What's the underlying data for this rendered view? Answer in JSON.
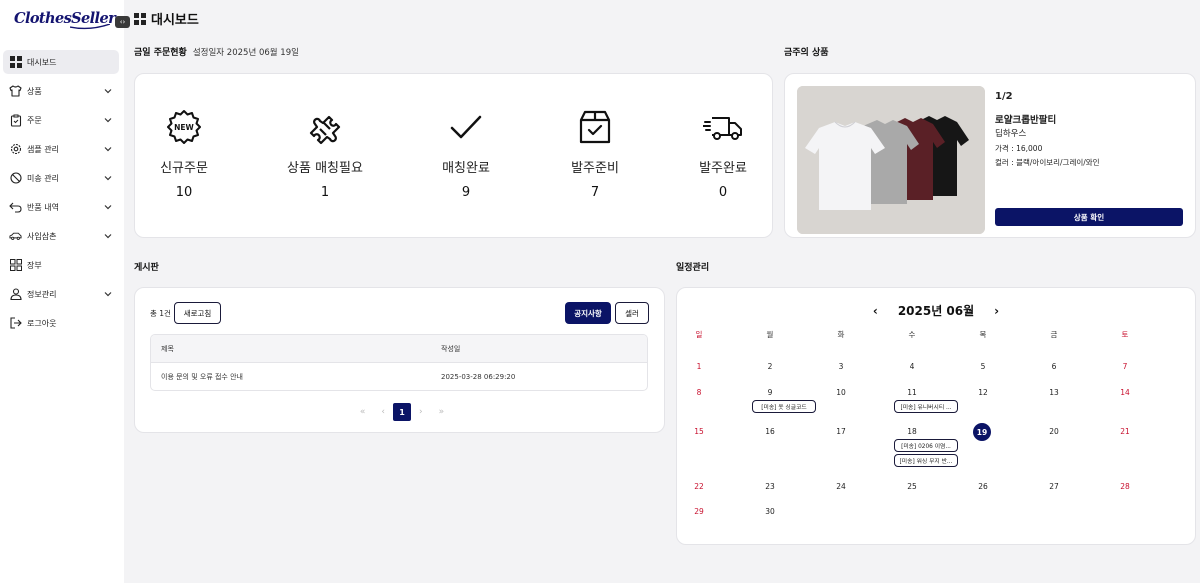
{
  "logo": {
    "text": "ClothesSeller"
  },
  "sidebar": {
    "items": [
      {
        "label": "대시보드",
        "icon": "grid-icon",
        "active": true,
        "chevron": false
      },
      {
        "label": "상품",
        "icon": "shirt-icon",
        "active": false,
        "chevron": true
      },
      {
        "label": "주문",
        "icon": "clipboard-icon",
        "active": false,
        "chevron": true
      },
      {
        "label": "샘플 관리",
        "icon": "gear-icon",
        "active": false,
        "chevron": true
      },
      {
        "label": "미송 관리",
        "icon": "ban-icon",
        "active": false,
        "chevron": true
      },
      {
        "label": "반품 내역",
        "icon": "return-arrow-icon",
        "active": false,
        "chevron": true
      },
      {
        "label": "사입삼촌",
        "icon": "car-icon",
        "active": false,
        "chevron": true
      },
      {
        "label": "장부",
        "icon": "ledger-grid-icon",
        "active": false,
        "chevron": false
      },
      {
        "label": "정보관리",
        "icon": "user-icon",
        "active": false,
        "chevron": true
      },
      {
        "label": "로그아웃",
        "icon": "logout-icon",
        "active": false,
        "chevron": false
      }
    ]
  },
  "header": {
    "title": "대시보드"
  },
  "orders": {
    "title": "금일 주문현황",
    "subtitle": "설정일자 2025년 06월 19일",
    "stats": [
      {
        "label": "신규주문",
        "value": "10",
        "icon": "new-badge-icon"
      },
      {
        "label": "상품 매칭필요",
        "value": "1",
        "icon": "puzzle-icon"
      },
      {
        "label": "매칭완료",
        "value": "9",
        "icon": "check-icon"
      },
      {
        "label": "발주준비",
        "value": "7",
        "icon": "box-check-icon"
      },
      {
        "label": "발주완료",
        "value": "0",
        "icon": "delivery-truck-icon"
      }
    ]
  },
  "weekly": {
    "title": "금주의 상품",
    "page": "1/2",
    "name": "로얄크롭반팔티",
    "brand": "딥하우스",
    "price": "가격 : 16,000",
    "colors": "컬러 : 블랙/아이보리/그레이/와인",
    "button": "상품 확인"
  },
  "board": {
    "title": "게시판",
    "total": "총 1건",
    "refresh": "새로고침",
    "notice_btn": "공지사항",
    "seller_btn": "셀러",
    "columns": [
      "제목",
      "작성일"
    ],
    "rows": [
      {
        "title": "이용 문의 및 오류 접수 안내",
        "date": "2025-03-28 06:29:20"
      }
    ],
    "pager": {
      "first": "«",
      "prev": "‹",
      "current": "1",
      "next": "›",
      "last": "»"
    }
  },
  "calendar": {
    "title": "일정관리",
    "month": "2025년 06월",
    "prev": "‹",
    "next": "›",
    "weekdays": [
      "일",
      "월",
      "화",
      "수",
      "목",
      "금",
      "토"
    ],
    "weeks": [
      [
        "1",
        "2",
        "3",
        "4",
        "5",
        "6",
        "7"
      ],
      [
        "8",
        "9",
        "10",
        "11",
        "12",
        "13",
        "14"
      ],
      [
        "15",
        "16",
        "17",
        "18",
        "19",
        "20",
        "21"
      ],
      [
        "22",
        "23",
        "24",
        "25",
        "26",
        "27",
        "28"
      ],
      [
        "29",
        "30",
        "",
        "",
        "",
        "",
        ""
      ]
    ],
    "today": "19",
    "events": [
      {
        "day": "9",
        "text": "[미송] 옷 싱글코드"
      },
      {
        "day": "11",
        "text": "[미송] 유니버시티 ..."
      },
      {
        "day": "18",
        "text": "[미송] 0206 이염..."
      },
      {
        "day": "18",
        "text": "[미송] 워싱 무지 반..."
      }
    ]
  },
  "colors": {
    "accent": "#0b1466",
    "sunday": "#c8102e",
    "saturday": "#c8102e",
    "background": "#f3f3f5"
  }
}
